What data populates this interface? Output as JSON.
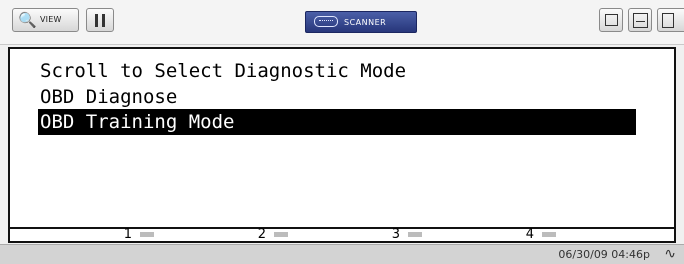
{
  "toolbar": {
    "view_label": "VIEW",
    "scanner_label": "SCANNER"
  },
  "screen": {
    "lines": [
      "Scroll to Select Diagnostic Mode",
      "OBD Diagnose",
      "OBD Training Mode"
    ],
    "selected_index": 2
  },
  "softkeys": [
    "1",
    "2",
    "3",
    "4"
  ],
  "status": {
    "datetime": "06/30/09 04:46p"
  },
  "colors": {
    "selection": "#000000",
    "scanner_badge": "#2f3f8a"
  }
}
